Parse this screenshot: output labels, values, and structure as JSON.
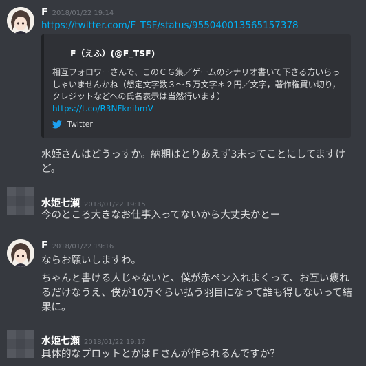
{
  "messages": [
    {
      "author": "F",
      "timestamp": "2018/01/22 19:14",
      "link": "https://twitter.com/F_TSF/status/955040013565157378",
      "embed": {
        "author": "F（えふ）(@F_TSF)",
        "description": "相互フォロワーさんで、このＣＧ集／ゲームのシナリオ書いて下さる方いらっしゃいませんかね（想定文字数３～５万文字＊２円／文字，著作権買い切り，クレジットなどへの氏名表示は当然行います）",
        "link": "https://t.co/R3NFknibmV",
        "footer": "Twitter"
      },
      "text": "水姫さんはどうっすか。納期はとりあえず3末ってことにしてますけど。"
    },
    {
      "author": "水姫七瀬",
      "timestamp": "2018/01/22 19:15",
      "text": "今のところ大きなお仕事入ってないから大丈夫かとー"
    },
    {
      "author": "F",
      "timestamp": "2018/01/22 19:16",
      "text1": "ならお願いしますわ。",
      "text2": "ちゃんと書ける人じゃないと、僕が赤ペン入れまくって、お互い疲れるだけなうえ、僕が10万ぐらい払う羽目になって誰も得しないって結果に。"
    },
    {
      "author": "水姫七瀬",
      "timestamp": "2018/01/22 19:17",
      "text": "具体的なプロットとかはＦさんが作られるんですか？"
    }
  ]
}
